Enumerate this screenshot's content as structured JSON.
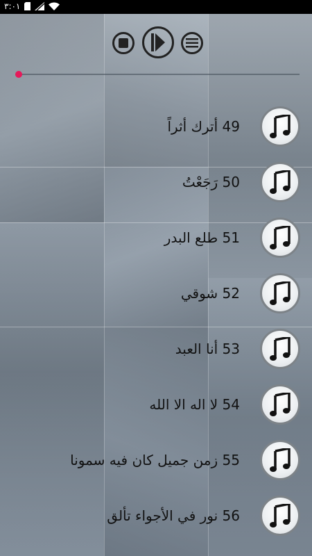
{
  "status_bar": {
    "time": "٣:٠١",
    "icons": [
      "sd-card-icon",
      "signal-icon",
      "wifi-icon"
    ]
  },
  "player": {
    "controls": [
      "stop-icon",
      "play-icon",
      "menu-icon"
    ],
    "progress_fraction": 0.0,
    "accent_color": "#e6195a"
  },
  "songs": [
    {
      "number": "49",
      "title": "49 أترك أثراً",
      "icon": "music-note-icon"
    },
    {
      "number": "50",
      "title": "50 رَجَعْتُ",
      "icon": "music-note-icon"
    },
    {
      "number": "51",
      "title": "51 طلع البدر",
      "icon": "music-note-icon"
    },
    {
      "number": "52",
      "title": "52 شوقي",
      "icon": "music-note-icon"
    },
    {
      "number": "53",
      "title": "53 أنا العبد",
      "icon": "music-note-icon"
    },
    {
      "number": "54",
      "title": "54 لا اله الا الله",
      "icon": "music-note-icon"
    },
    {
      "number": "55",
      "title": "55 زمن جميل كان فيه سمونا",
      "icon": "music-note-icon"
    },
    {
      "number": "56",
      "title": "56 نور في الأجواء تألق",
      "icon": "music-note-icon"
    }
  ]
}
